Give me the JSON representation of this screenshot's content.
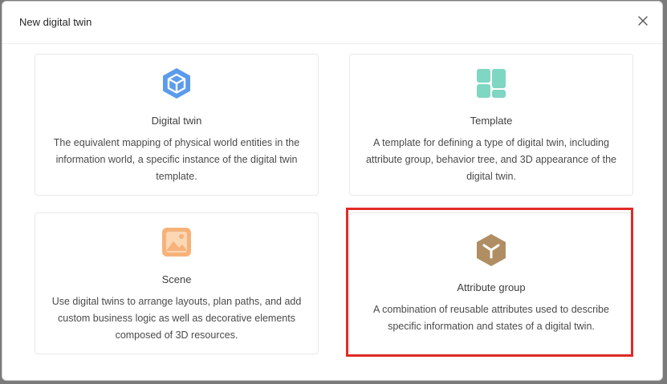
{
  "dialog": {
    "title": "New digital twin",
    "close_icon": "close-icon"
  },
  "cards": {
    "digital_twin": {
      "icon": "cube-icon",
      "name": "Digital twin",
      "description": "The equivalent mapping of physical world entities in the information world, a specific instance of the digital twin template.",
      "color": "#5b9bec"
    },
    "template": {
      "icon": "grid-layout-icon",
      "name": "Template",
      "description": "A template for defining a type of digital twin, including attribute group, behavior tree, and 3D appearance of the digital twin.",
      "color": "#7fd6c2"
    },
    "scene": {
      "icon": "image-icon",
      "name": "Scene",
      "description": "Use digital twins to arrange layouts, plan paths, and add custom business logic as well as decorative elements composed of 3D resources.",
      "color": "#f7b27a"
    },
    "attribute_group": {
      "icon": "attribute-cube-icon",
      "name": "Attribute group",
      "description": "A combination of reusable attributes used to describe specific information and states of a digital twin.",
      "color": "#b08e63"
    }
  },
  "highlight_color": "#e02b27"
}
